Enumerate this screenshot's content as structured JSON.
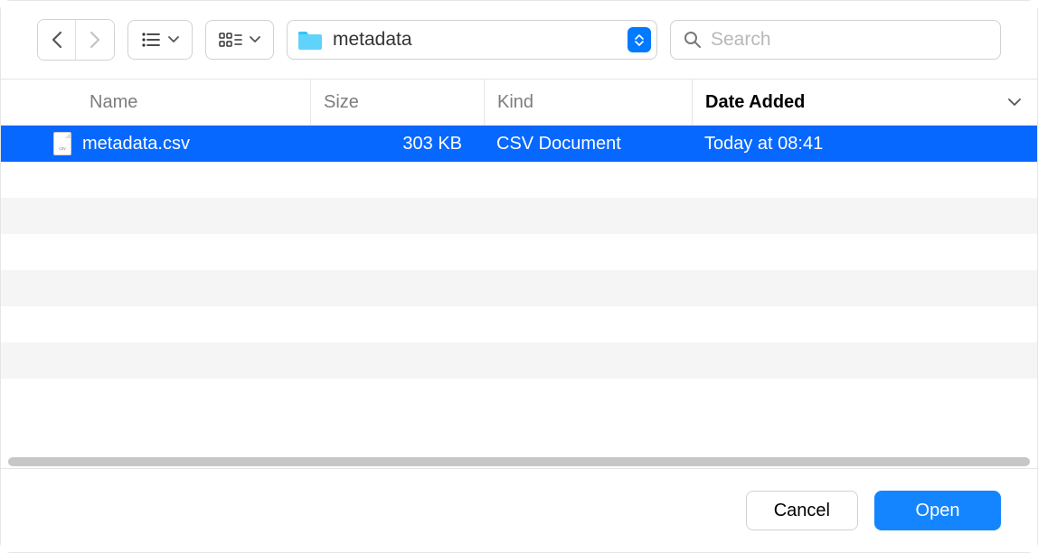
{
  "toolbar": {
    "path_label": "metadata",
    "search_placeholder": "Search"
  },
  "columns": {
    "name": "Name",
    "size": "Size",
    "kind": "Kind",
    "date_added": "Date Added"
  },
  "files": [
    {
      "name": "metadata.csv",
      "size": "303 KB",
      "kind": "CSV Document",
      "date_added": "Today at 08:41",
      "selected": true
    }
  ],
  "footer": {
    "cancel": "Cancel",
    "open": "Open"
  }
}
